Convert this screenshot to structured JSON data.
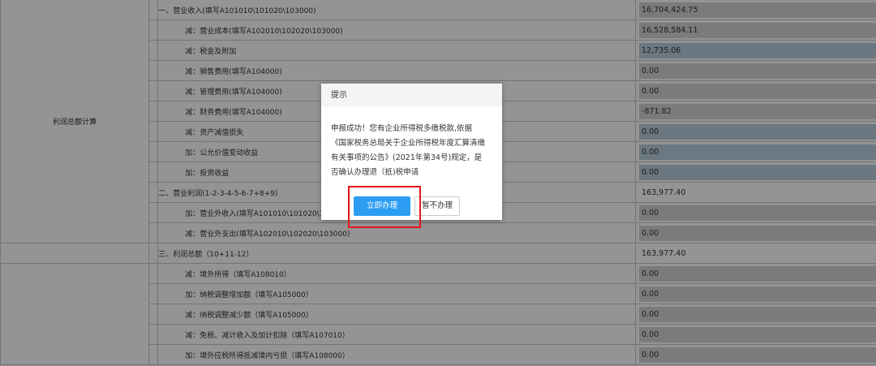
{
  "table": {
    "group_label": "利润总额计算",
    "rows": [
      {
        "label": "一、营业收入(填写A101010\\101020\\103000)",
        "value": "16,704,424.75"
      },
      {
        "label": "减：营业成本(填写A102010\\102020\\103000)",
        "value": "16,528,584.11"
      },
      {
        "label": "减：税金及附加",
        "value": "12,735.06"
      },
      {
        "label": "减：销售费用(填写A104000)",
        "value": "0.00"
      },
      {
        "label": "减：管理费用(填写A104000)",
        "value": "0.00"
      },
      {
        "label": "减：财务费用(填写A104000)",
        "value": "-871.82"
      },
      {
        "label": "减：资产减值损失",
        "value": "0.00"
      },
      {
        "label": "加：公允价值变动收益",
        "value": "0.00"
      },
      {
        "label": "加：投资收益",
        "value": "0.00"
      },
      {
        "label": "二、营业利润(1-2-3-4-5-6-7+8+9)",
        "value": "163,977.40"
      },
      {
        "label": "加：营业外收入(填写A101010\\101020\\103000)",
        "value": "0.00"
      },
      {
        "label": "减：营业外支出(填写A102010\\102020\\103000)",
        "value": "0.00"
      },
      {
        "label": "三、利润总额（10+11-12）",
        "value": "163,977.40"
      },
      {
        "label": "减：境外所得（填写A108010）",
        "value": "0.00"
      },
      {
        "label": "加：纳税调整增加额（填写A105000）",
        "value": "0.00"
      },
      {
        "label": "减：纳税调整减少额（填写A105000）",
        "value": "0.00"
      },
      {
        "label": "减：免税、减计收入及加计扣除（填写A107010）",
        "value": "0.00"
      },
      {
        "label": "加：境外应税所得抵减境内亏损（填写A108000）",
        "value": "0.00"
      }
    ]
  },
  "dialog": {
    "title": "提示",
    "message_lines": [
      "申报成功！您有企业所得税多缴税款,依据",
      "《国家税务总局关于企业所得税年度汇算清缴",
      "有关事项的公告》(2021年第34号)规定，是",
      "否确认办理退（抵)税申请"
    ],
    "confirm_label": "立即办理",
    "cancel_label": "暂不办理"
  },
  "colors": {
    "primary_button": "#2b9df2",
    "highlight_box": "#e8141b",
    "value_gray": "#d4d4d4",
    "value_blue": "#b8cfe0"
  }
}
